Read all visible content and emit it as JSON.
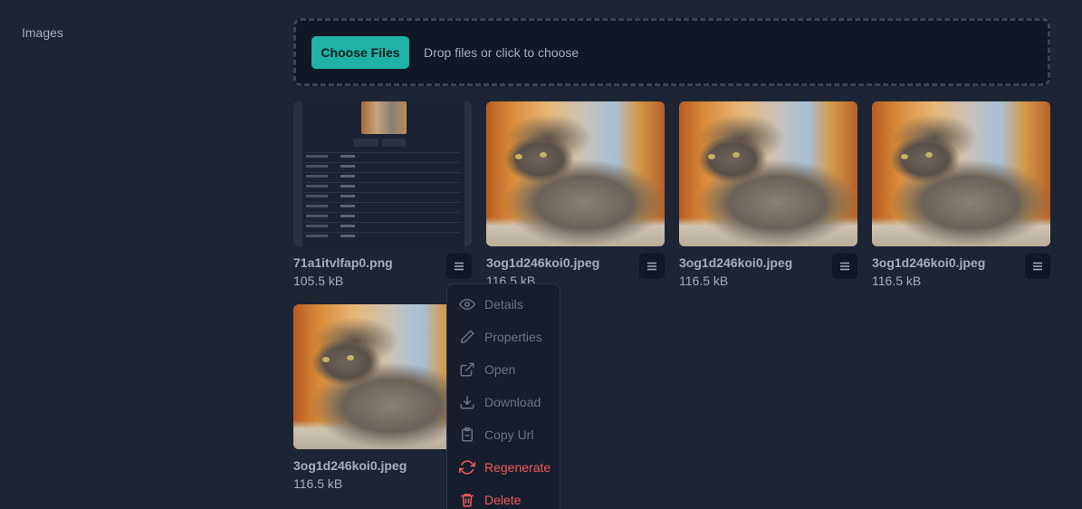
{
  "sidebar": {
    "label": "Images"
  },
  "upload": {
    "button_label": "Choose Files",
    "hint": "Drop files or click to choose"
  },
  "files": [
    {
      "name": "71a1itvlfap0.png",
      "size": "105.5 kB"
    },
    {
      "name": "3og1d246koi0.jpeg",
      "size": "116.5 kB"
    },
    {
      "name": "3og1d246koi0.jpeg",
      "size": "116.5 kB"
    },
    {
      "name": "3og1d246koi0.jpeg",
      "size": "116.5 kB"
    },
    {
      "name": "3og1d246koi0.jpeg",
      "size": "116.5 kB"
    }
  ],
  "menu": {
    "items": [
      {
        "label": "Details",
        "icon": "eye-icon"
      },
      {
        "label": "Properties",
        "icon": "pencil-icon"
      },
      {
        "label": "Open",
        "icon": "external-link-icon"
      },
      {
        "label": "Download",
        "icon": "download-icon"
      },
      {
        "label": "Copy Url",
        "icon": "clipboard-icon"
      },
      {
        "label": "Regenerate",
        "icon": "refresh-icon"
      },
      {
        "label": "Delete",
        "icon": "trash-icon"
      }
    ]
  },
  "colors": {
    "accent": "#1fb2a5",
    "danger": "#f05a5a",
    "background": "#1d2535"
  }
}
